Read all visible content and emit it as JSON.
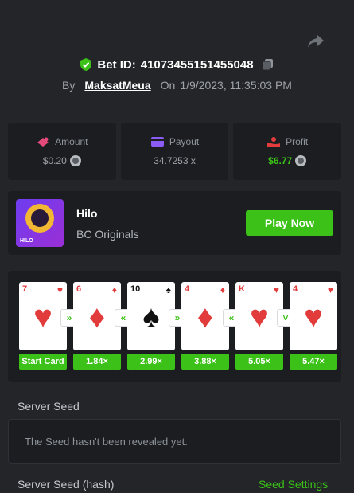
{
  "header": {
    "bet_id_label": "Bet ID:",
    "bet_id": "41073455151455048",
    "by_label": "By",
    "username": "MaksatMeua",
    "on_label": "On",
    "datetime": "1/9/2023, 11:35:03 PM"
  },
  "stats": {
    "amount": {
      "label": "Amount",
      "value": "$0.20"
    },
    "payout": {
      "label": "Payout",
      "value": "34.7253 x"
    },
    "profit": {
      "label": "Profit",
      "value": "$6.77"
    }
  },
  "game": {
    "thumb_text": "HILO",
    "name": "Hilo",
    "provider": "BC Originals",
    "play_label": "Play Now"
  },
  "cards": [
    {
      "rank": "7",
      "suit": "♥",
      "color": "red",
      "mult": "Start Card",
      "arrow": "»"
    },
    {
      "rank": "6",
      "suit": "♦",
      "color": "red",
      "mult": "1.84×",
      "arrow": "«"
    },
    {
      "rank": "10",
      "suit": "♠",
      "color": "black",
      "mult": "2.99×",
      "arrow": "»"
    },
    {
      "rank": "4",
      "suit": "♦",
      "color": "red",
      "mult": "3.88×",
      "arrow": "«"
    },
    {
      "rank": "K",
      "suit": "♥",
      "color": "red",
      "mult": "5.05×",
      "arrow": "˅"
    },
    {
      "rank": "4",
      "suit": "♥",
      "color": "red",
      "mult": "5.47×",
      "arrow": ""
    }
  ],
  "server_seed": {
    "label": "Server Seed",
    "value": "The Seed hasn't been revealed yet.",
    "hash_label": "Server Seed (hash)",
    "settings_label": "Seed Settings"
  },
  "colors": {
    "accent": "#3bc117",
    "background": "#232529",
    "panel": "#1b1d21",
    "card_red": "#e13b3b"
  }
}
